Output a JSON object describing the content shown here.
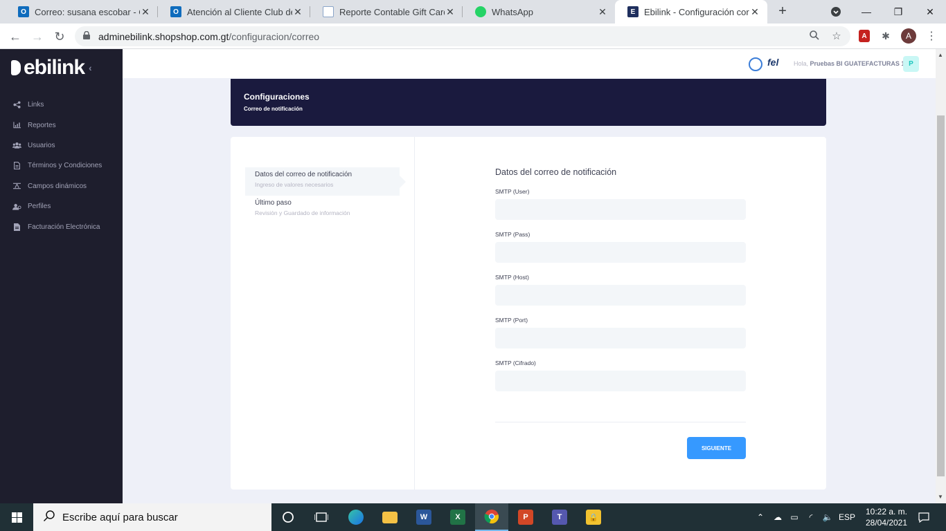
{
  "browser": {
    "tabs": [
      {
        "title": "Correo: susana escobar - Out",
        "icon": "outlook-icon"
      },
      {
        "title": "Atención al Cliente Club de C",
        "icon": "outlook-icon"
      },
      {
        "title": "Reporte Contable Gift Cards -",
        "icon": "document-icon"
      },
      {
        "title": "WhatsApp",
        "icon": "whatsapp-icon"
      },
      {
        "title": "Ebilink - Configuración corre",
        "icon": "ebilink-icon"
      }
    ],
    "url_host": "adminebilink.shopshop.com.gt",
    "url_path": "/configuracion/correo",
    "profile_initial": "A"
  },
  "app": {
    "logo_text": "ebilink",
    "sidebar": {
      "items": [
        {
          "label": "Links",
          "icon": "share-icon"
        },
        {
          "label": "Reportes",
          "icon": "chart-icon"
        },
        {
          "label": "Usuarios",
          "icon": "users-icon"
        },
        {
          "label": "Términos y Condiciones",
          "icon": "document-icon"
        },
        {
          "label": "Campos dinámicos",
          "icon": "sliders-icon"
        },
        {
          "label": "Perfiles",
          "icon": "profiles-icon"
        },
        {
          "label": "Facturación Electrónica",
          "icon": "invoice-icon"
        }
      ]
    },
    "header": {
      "fel_logo": "fel",
      "greeting": "Hola,",
      "user_name": "Pruebas BI GUATEFACTURAS 1",
      "avatar_initial": "P"
    },
    "hero": {
      "title": "Configuraciones",
      "subtitle": "Correo de notificación"
    },
    "steps": [
      {
        "title": "Datos del correo de notificación",
        "description": "Ingreso de valores necesarios",
        "active": true
      },
      {
        "title": "Último paso",
        "description": "Revisión y Guardado de información",
        "active": false
      }
    ],
    "form": {
      "title": "Datos del correo de notificación",
      "fields": [
        {
          "label": "SMTP (User)",
          "value": ""
        },
        {
          "label": "SMTP (Pass)",
          "value": ""
        },
        {
          "label": "SMTP (Host)",
          "value": ""
        },
        {
          "label": "SMTP (Port)",
          "value": ""
        },
        {
          "label": "SMTP (Cifrado)",
          "value": ""
        }
      ],
      "next_label": "SIGUIENTE"
    },
    "colors": {
      "sidebar_bg": "#1e1e2d",
      "hero_bg": "#1a1a3e",
      "primary": "#3699ff"
    }
  },
  "taskbar": {
    "search_placeholder": "Escribe aquí para buscar",
    "language": "ESP",
    "time": "10:22 a. m.",
    "date": "28/04/2021",
    "apps": [
      "task-view-icon",
      "edge-icon",
      "file-explorer-icon",
      "word-icon",
      "excel-icon",
      "chrome-icon",
      "powerpoint-icon",
      "teams-icon",
      "lock-app-icon"
    ]
  }
}
